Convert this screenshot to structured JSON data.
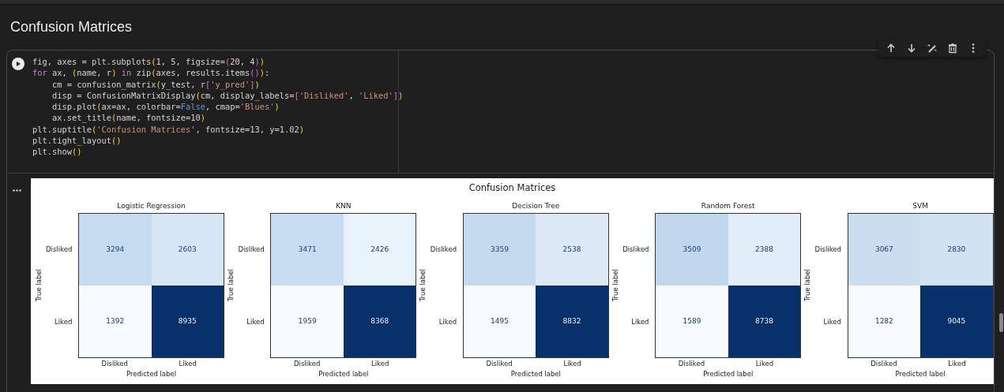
{
  "heading": "Confusion Matrices",
  "code_lines": [
    [
      {
        "kind": "p",
        "text": "fig, axes = plt.subplots"
      },
      {
        "kind": "y",
        "text": "("
      },
      {
        "kind": "p",
        "text": "1, 5, figsize="
      },
      {
        "kind": "m",
        "text": "("
      },
      {
        "kind": "p",
        "text": "20, 4"
      },
      {
        "kind": "m",
        "text": ")"
      },
      {
        "kind": "y",
        "text": ")"
      }
    ],
    [
      {
        "kind": "k",
        "text": "for"
      },
      {
        "kind": "p",
        "text": " ax, "
      },
      {
        "kind": "y",
        "text": "("
      },
      {
        "kind": "p",
        "text": "name, r"
      },
      {
        "kind": "y",
        "text": ")"
      },
      {
        "kind": "k",
        "text": " in"
      },
      {
        "kind": "p",
        "text": " zip"
      },
      {
        "kind": "y",
        "text": "("
      },
      {
        "kind": "p",
        "text": "axes, results.items"
      },
      {
        "kind": "m",
        "text": "()"
      },
      {
        "kind": "y",
        "text": ")"
      },
      {
        "kind": "p",
        "text": ":"
      }
    ],
    [
      {
        "kind": "p",
        "text": "    cm = confusion_matrix"
      },
      {
        "kind": "y",
        "text": "("
      },
      {
        "kind": "p",
        "text": "y_test, r"
      },
      {
        "kind": "m",
        "text": "["
      },
      {
        "kind": "s",
        "text": "'y_pred'"
      },
      {
        "kind": "m",
        "text": "]"
      },
      {
        "kind": "y",
        "text": ")"
      }
    ],
    [
      {
        "kind": "p",
        "text": "    disp = ConfusionMatrixDisplay"
      },
      {
        "kind": "y",
        "text": "("
      },
      {
        "kind": "p",
        "text": "cm, display_labels="
      },
      {
        "kind": "m",
        "text": "["
      },
      {
        "kind": "s",
        "text": "'Disliked'"
      },
      {
        "kind": "p",
        "text": ", "
      },
      {
        "kind": "s",
        "text": "'Liked'"
      },
      {
        "kind": "m",
        "text": "]"
      },
      {
        "kind": "y",
        "text": ")"
      }
    ],
    [
      {
        "kind": "p",
        "text": "    disp.plot"
      },
      {
        "kind": "y",
        "text": "("
      },
      {
        "kind": "p",
        "text": "ax=ax, colorbar="
      },
      {
        "kind": "b",
        "text": "False"
      },
      {
        "kind": "p",
        "text": ", cmap="
      },
      {
        "kind": "s",
        "text": "'Blues'"
      },
      {
        "kind": "y",
        "text": ")"
      }
    ],
    [
      {
        "kind": "p",
        "text": "    ax.set_title"
      },
      {
        "kind": "y",
        "text": "("
      },
      {
        "kind": "p",
        "text": "name, fontsize=10"
      },
      {
        "kind": "y",
        "text": ")"
      }
    ],
    [
      {
        "kind": "p",
        "text": "plt.suptitle"
      },
      {
        "kind": "y",
        "text": "("
      },
      {
        "kind": "s",
        "text": "'Confusion Matrices'"
      },
      {
        "kind": "p",
        "text": ", fontsize=13, y=1.02"
      },
      {
        "kind": "y",
        "text": ")"
      }
    ],
    [
      {
        "kind": "p",
        "text": "plt.tight_layout"
      },
      {
        "kind": "y",
        "text": "()"
      }
    ],
    [
      {
        "kind": "p",
        "text": "plt.show"
      },
      {
        "kind": "y",
        "text": "()"
      }
    ]
  ],
  "figure": {
    "suptitle": "Confusion Matrices",
    "matrices": [
      {
        "title": "Logistic Regression",
        "ylabel": "True label",
        "xlabel": "Predicted label",
        "row_labels": [
          "Disliked",
          "Liked"
        ],
        "col_labels": [
          "Disliked",
          "Liked"
        ],
        "cells": [
          [
            "3294",
            "2603"
          ],
          [
            "1392",
            "8935"
          ]
        ]
      },
      {
        "title": "KNN",
        "ylabel": "True label",
        "xlabel": "Predicted label",
        "row_labels": [
          "Disliked",
          "Liked"
        ],
        "col_labels": [
          "Disliked",
          "Liked"
        ],
        "cells": [
          [
            "3471",
            "2426"
          ],
          [
            "1959",
            "8368"
          ]
        ]
      },
      {
        "title": "Decision Tree",
        "ylabel": "True label",
        "xlabel": "Predicted label",
        "row_labels": [
          "Disliked",
          "Liked"
        ],
        "col_labels": [
          "Disliked",
          "Liked"
        ],
        "cells": [
          [
            "3359",
            "2538"
          ],
          [
            "1495",
            "8832"
          ]
        ]
      },
      {
        "title": "Random Forest",
        "ylabel": "True label",
        "xlabel": "Predicted label",
        "row_labels": [
          "Disliked",
          "Liked"
        ],
        "col_labels": [
          "Disliked",
          "Liked"
        ],
        "cells": [
          [
            "3509",
            "2388"
          ],
          [
            "1589",
            "8738"
          ]
        ]
      },
      {
        "title": "SVM",
        "ylabel": "True label",
        "xlabel": "Predicted label",
        "row_labels": [
          "Disliked",
          "Liked"
        ],
        "col_labels": [
          "Disliked",
          "Liked"
        ],
        "cells": [
          [
            "3067",
            "2830"
          ],
          [
            "1282",
            "9045"
          ]
        ]
      }
    ]
  }
}
